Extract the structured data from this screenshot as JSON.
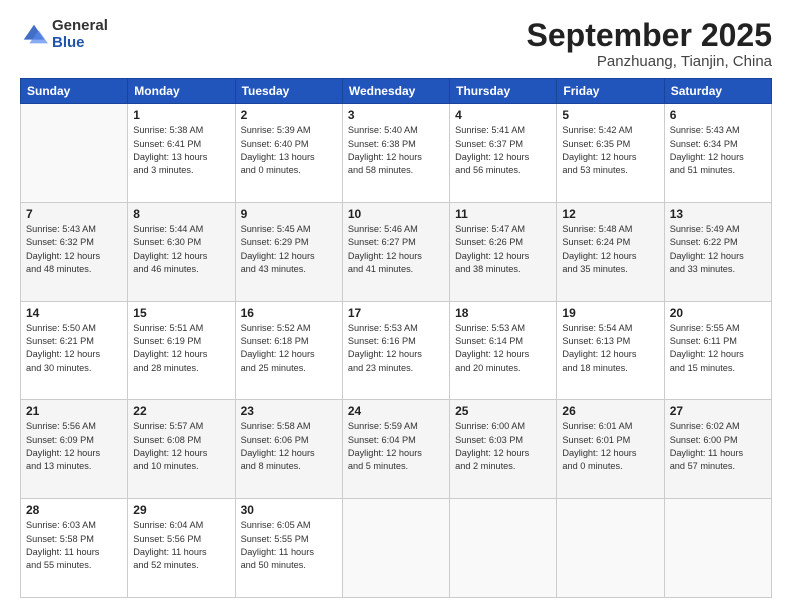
{
  "logo": {
    "general": "General",
    "blue": "Blue"
  },
  "header": {
    "month": "September 2025",
    "location": "Panzhuang, Tianjin, China"
  },
  "days": [
    "Sunday",
    "Monday",
    "Tuesday",
    "Wednesday",
    "Thursday",
    "Friday",
    "Saturday"
  ],
  "weeks": [
    [
      {
        "day": "",
        "info": ""
      },
      {
        "day": "1",
        "info": "Sunrise: 5:38 AM\nSunset: 6:41 PM\nDaylight: 13 hours\nand 3 minutes."
      },
      {
        "day": "2",
        "info": "Sunrise: 5:39 AM\nSunset: 6:40 PM\nDaylight: 13 hours\nand 0 minutes."
      },
      {
        "day": "3",
        "info": "Sunrise: 5:40 AM\nSunset: 6:38 PM\nDaylight: 12 hours\nand 58 minutes."
      },
      {
        "day": "4",
        "info": "Sunrise: 5:41 AM\nSunset: 6:37 PM\nDaylight: 12 hours\nand 56 minutes."
      },
      {
        "day": "5",
        "info": "Sunrise: 5:42 AM\nSunset: 6:35 PM\nDaylight: 12 hours\nand 53 minutes."
      },
      {
        "day": "6",
        "info": "Sunrise: 5:43 AM\nSunset: 6:34 PM\nDaylight: 12 hours\nand 51 minutes."
      }
    ],
    [
      {
        "day": "7",
        "info": "Sunrise: 5:43 AM\nSunset: 6:32 PM\nDaylight: 12 hours\nand 48 minutes."
      },
      {
        "day": "8",
        "info": "Sunrise: 5:44 AM\nSunset: 6:30 PM\nDaylight: 12 hours\nand 46 minutes."
      },
      {
        "day": "9",
        "info": "Sunrise: 5:45 AM\nSunset: 6:29 PM\nDaylight: 12 hours\nand 43 minutes."
      },
      {
        "day": "10",
        "info": "Sunrise: 5:46 AM\nSunset: 6:27 PM\nDaylight: 12 hours\nand 41 minutes."
      },
      {
        "day": "11",
        "info": "Sunrise: 5:47 AM\nSunset: 6:26 PM\nDaylight: 12 hours\nand 38 minutes."
      },
      {
        "day": "12",
        "info": "Sunrise: 5:48 AM\nSunset: 6:24 PM\nDaylight: 12 hours\nand 35 minutes."
      },
      {
        "day": "13",
        "info": "Sunrise: 5:49 AM\nSunset: 6:22 PM\nDaylight: 12 hours\nand 33 minutes."
      }
    ],
    [
      {
        "day": "14",
        "info": "Sunrise: 5:50 AM\nSunset: 6:21 PM\nDaylight: 12 hours\nand 30 minutes."
      },
      {
        "day": "15",
        "info": "Sunrise: 5:51 AM\nSunset: 6:19 PM\nDaylight: 12 hours\nand 28 minutes."
      },
      {
        "day": "16",
        "info": "Sunrise: 5:52 AM\nSunset: 6:18 PM\nDaylight: 12 hours\nand 25 minutes."
      },
      {
        "day": "17",
        "info": "Sunrise: 5:53 AM\nSunset: 6:16 PM\nDaylight: 12 hours\nand 23 minutes."
      },
      {
        "day": "18",
        "info": "Sunrise: 5:53 AM\nSunset: 6:14 PM\nDaylight: 12 hours\nand 20 minutes."
      },
      {
        "day": "19",
        "info": "Sunrise: 5:54 AM\nSunset: 6:13 PM\nDaylight: 12 hours\nand 18 minutes."
      },
      {
        "day": "20",
        "info": "Sunrise: 5:55 AM\nSunset: 6:11 PM\nDaylight: 12 hours\nand 15 minutes."
      }
    ],
    [
      {
        "day": "21",
        "info": "Sunrise: 5:56 AM\nSunset: 6:09 PM\nDaylight: 12 hours\nand 13 minutes."
      },
      {
        "day": "22",
        "info": "Sunrise: 5:57 AM\nSunset: 6:08 PM\nDaylight: 12 hours\nand 10 minutes."
      },
      {
        "day": "23",
        "info": "Sunrise: 5:58 AM\nSunset: 6:06 PM\nDaylight: 12 hours\nand 8 minutes."
      },
      {
        "day": "24",
        "info": "Sunrise: 5:59 AM\nSunset: 6:04 PM\nDaylight: 12 hours\nand 5 minutes."
      },
      {
        "day": "25",
        "info": "Sunrise: 6:00 AM\nSunset: 6:03 PM\nDaylight: 12 hours\nand 2 minutes."
      },
      {
        "day": "26",
        "info": "Sunrise: 6:01 AM\nSunset: 6:01 PM\nDaylight: 12 hours\nand 0 minutes."
      },
      {
        "day": "27",
        "info": "Sunrise: 6:02 AM\nSunset: 6:00 PM\nDaylight: 11 hours\nand 57 minutes."
      }
    ],
    [
      {
        "day": "28",
        "info": "Sunrise: 6:03 AM\nSunset: 5:58 PM\nDaylight: 11 hours\nand 55 minutes."
      },
      {
        "day": "29",
        "info": "Sunrise: 6:04 AM\nSunset: 5:56 PM\nDaylight: 11 hours\nand 52 minutes."
      },
      {
        "day": "30",
        "info": "Sunrise: 6:05 AM\nSunset: 5:55 PM\nDaylight: 11 hours\nand 50 minutes."
      },
      {
        "day": "",
        "info": ""
      },
      {
        "day": "",
        "info": ""
      },
      {
        "day": "",
        "info": ""
      },
      {
        "day": "",
        "info": ""
      }
    ]
  ]
}
